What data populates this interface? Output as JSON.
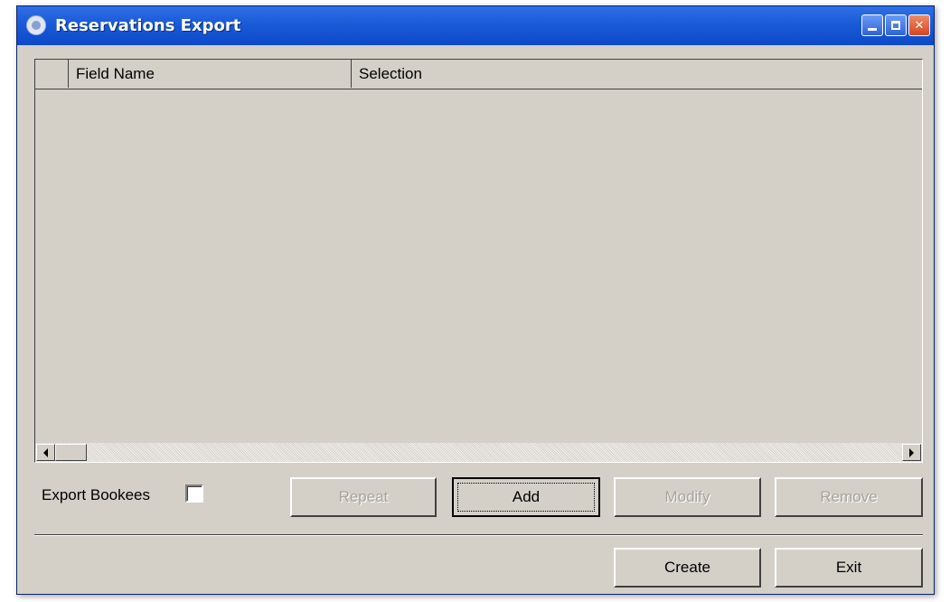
{
  "window": {
    "title": "Reservations Export",
    "icons": {
      "app": "app-logo-icon",
      "minimize": "minimize-icon",
      "maximize": "maximize-icon",
      "close": "close-icon"
    },
    "close_glyph": "✕"
  },
  "grid": {
    "columns": [
      "",
      "Field Name",
      "Selection"
    ],
    "rows": []
  },
  "options": {
    "export_bookees_label": "Export Bookees",
    "export_bookees_checked": false
  },
  "buttons": {
    "repeat": "Repeat",
    "add": "Add",
    "modify": "Modify",
    "remove": "Remove",
    "create": "Create",
    "exit": "Exit"
  },
  "colors": {
    "titlebar": "#0c49c9",
    "face": "#d4d0c8",
    "disabled_text": "#a6a39c"
  }
}
